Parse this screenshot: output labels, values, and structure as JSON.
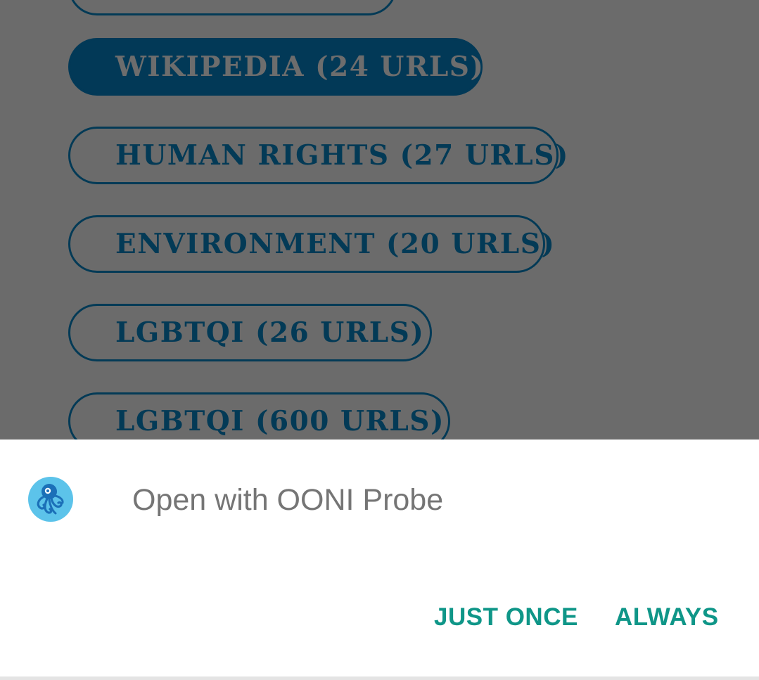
{
  "categories": [
    {
      "label": "WIKIPEDIA (24 URLS)",
      "selected": true
    },
    {
      "label": "HUMAN RIGHTS (27 URLS)",
      "selected": false
    },
    {
      "label": "ENVIRONMENT (20 URLS)",
      "selected": false
    },
    {
      "label": "LGBTQI (26 URLS)",
      "selected": false
    },
    {
      "label": "LGBTQI (600 URLS)",
      "selected": false
    }
  ],
  "dialog": {
    "app_icon": "octopus-app-icon",
    "title": "Open with OONI Probe",
    "just_once_label": "JUST ONCE",
    "always_label": "ALWAYS"
  },
  "colors": {
    "scrim": "#6b6b6b",
    "pill_navy": "#033a56",
    "accent_teal": "#0f9688",
    "icon_blue": "#5cc3ea"
  }
}
